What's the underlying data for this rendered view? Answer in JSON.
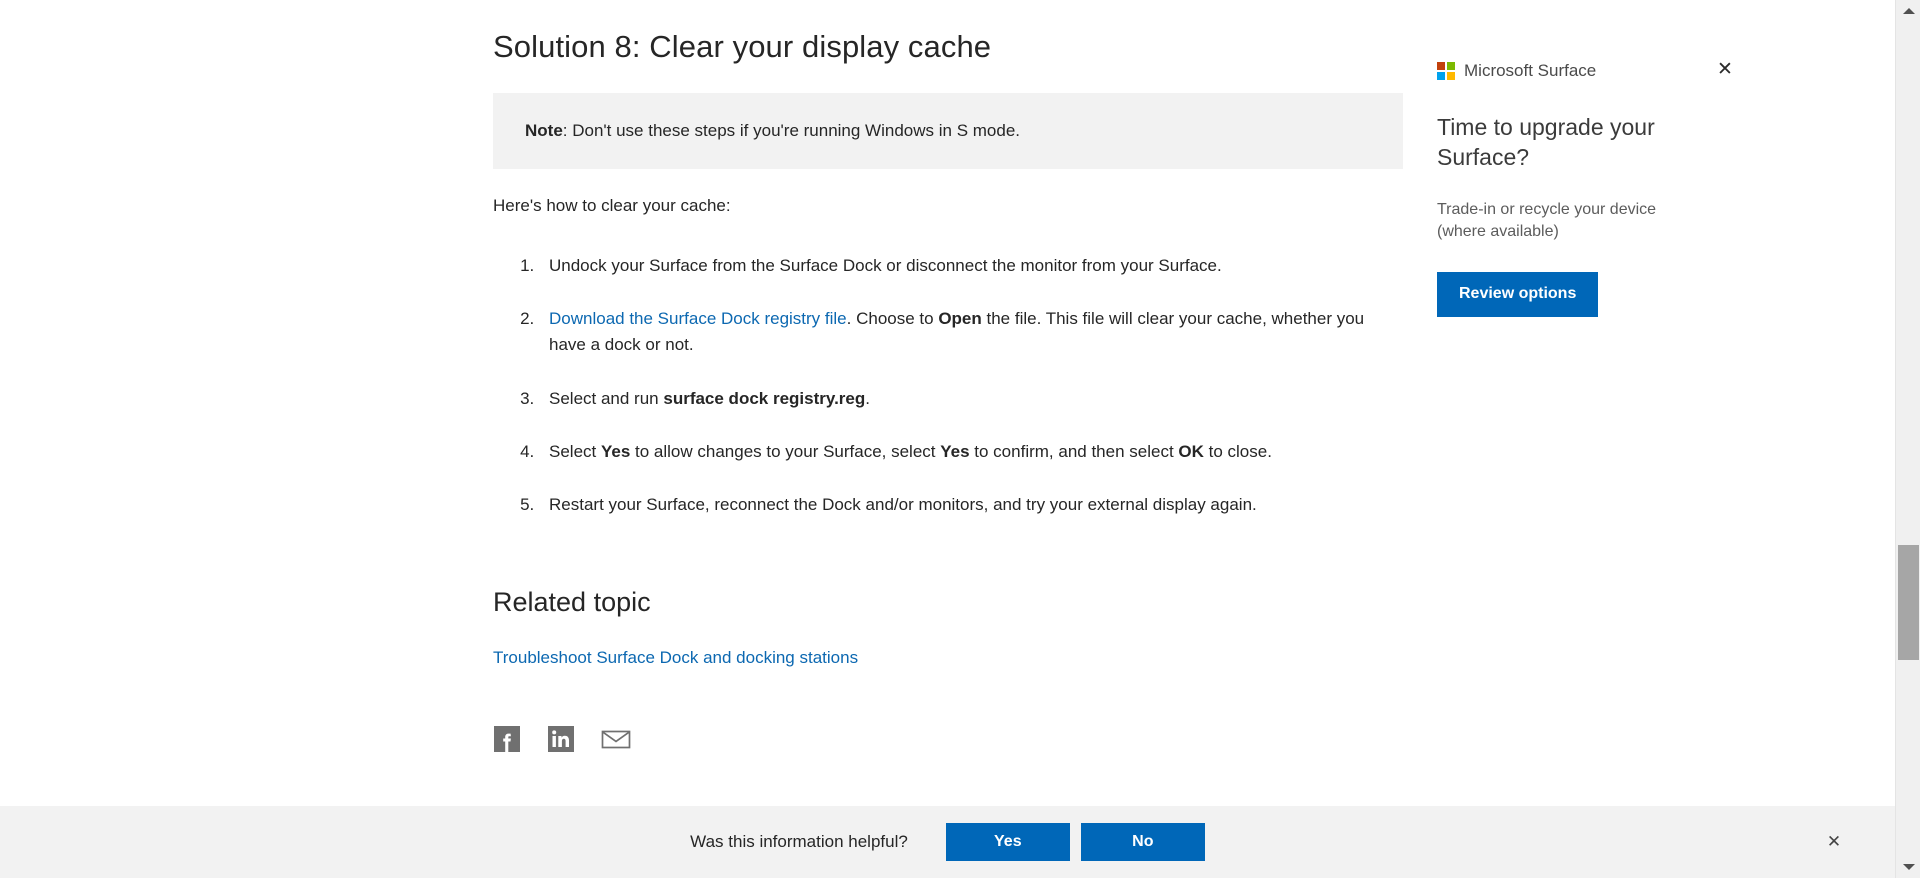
{
  "article": {
    "title": "Solution 8: Clear your display cache",
    "note": {
      "label": "Note",
      "text": ": Don't use these steps if you're running Windows in S mode."
    },
    "lead": "Here's how to clear your cache:",
    "steps": [
      {
        "parts": [
          {
            "type": "text",
            "text": "Undock your Surface from the Surface Dock or disconnect the monitor from your Surface."
          }
        ]
      },
      {
        "parts": [
          {
            "type": "link",
            "text": "Download the Surface Dock registry file"
          },
          {
            "type": "text",
            "text": ". Choose to "
          },
          {
            "type": "bold",
            "text": "Open"
          },
          {
            "type": "text",
            "text": " the file. This file will clear your cache, whether you have a dock or not."
          }
        ]
      },
      {
        "parts": [
          {
            "type": "text",
            "text": "Select and run "
          },
          {
            "type": "bold",
            "text": "surface dock registry.reg"
          },
          {
            "type": "text",
            "text": "."
          }
        ]
      },
      {
        "parts": [
          {
            "type": "text",
            "text": "Select "
          },
          {
            "type": "bold",
            "text": "Yes"
          },
          {
            "type": "text",
            "text": " to allow changes to your Surface, select "
          },
          {
            "type": "bold",
            "text": "Yes"
          },
          {
            "type": "text",
            "text": " to confirm, and then select "
          },
          {
            "type": "bold",
            "text": "OK"
          },
          {
            "type": "text",
            "text": " to close."
          }
        ]
      },
      {
        "parts": [
          {
            "type": "text",
            "text": "Restart your Surface, reconnect the Dock and/or monitors, and try your external display again."
          }
        ]
      }
    ],
    "related_heading": "Related topic",
    "related_link": "Troubleshoot Surface Dock and docking stations",
    "share": [
      {
        "icon": "facebook-icon",
        "label": "Share on Facebook"
      },
      {
        "icon": "linkedin-icon",
        "label": "Share on LinkedIn"
      },
      {
        "icon": "email-icon",
        "label": "Share by email"
      }
    ]
  },
  "promo": {
    "brand": "Microsoft Surface",
    "close_icon": "✕",
    "headline": "Time to upgrade your Surface?",
    "body": "Trade-in or recycle your device (where available)",
    "cta_label": "Review options",
    "logo_colors": [
      "#c2410c",
      "#7cb900",
      "#00a2ed",
      "#ffb900"
    ],
    "cta_color": "#0067b8"
  },
  "feedback": {
    "question": "Was this information helpful?",
    "yes_label": "Yes",
    "no_label": "No",
    "close_icon": "✕",
    "button_color": "#0067b8"
  },
  "scrollbar": {
    "up_icon": "scroll-up-arrow",
    "down_icon": "scroll-down-arrow"
  },
  "colors": {
    "link": "#0c68b1",
    "note_background": "#f2f2f2",
    "text": "#262626"
  }
}
